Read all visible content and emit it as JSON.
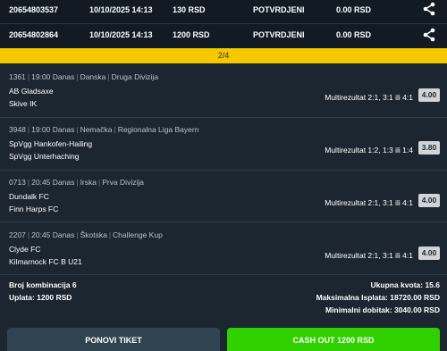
{
  "tickets": [
    {
      "id": "20654803537",
      "datetime": "10/10/2025 14:13",
      "amount": "130 RSD",
      "status": "POTVRDJENI",
      "win": "0.00 RSD",
      "share_icon": "share-icon"
    },
    {
      "id": "20654802864",
      "datetime": "10/10/2025 14:13",
      "amount": "1200 RSD",
      "status": "POTVRDJENI",
      "win": "0.00 RSD",
      "share_icon": "share-icon"
    }
  ],
  "pagination": {
    "label": "2/4"
  },
  "matches": [
    {
      "code": "1361",
      "time": "19:00 Danas",
      "country": "Danska",
      "league": "Druga Divizija",
      "home": "AB Gladsaxe",
      "away": "Skive IK",
      "tip": "Multirezultat 2:1, 3:1 ili 4:1",
      "odd": "4.00"
    },
    {
      "code": "3948",
      "time": "19:00 Danas",
      "country": "Nemačka",
      "league": "Regionalna Liga Bayern",
      "home": "SpVgg Hankofen-Hailing",
      "away": "SpVgg Unterhaching",
      "tip": "Multirezultat 1:2, 1:3 ili 1:4",
      "odd": "3.80"
    },
    {
      "code": "0713",
      "time": "20:45 Danas",
      "country": "Irska",
      "league": "Prva Divizija",
      "home": "Dundalk FC",
      "away": "Finn Harps FC",
      "tip": "Multirezultat 2:1, 3:1 ili 4:1",
      "odd": "4.00"
    },
    {
      "code": "2207",
      "time": "20:45 Danas",
      "country": "Škotska",
      "league": "Challenge Kup",
      "home": "Clyde FC",
      "away": "Kilmarnock FC B U21",
      "tip": "Multirezultat 2:1, 3:1 ili 4:1",
      "odd": "4.00"
    }
  ],
  "summary": {
    "combinations": "Broj kombinacija 6",
    "stake": "Uplata: 1200 RSD",
    "total_odds": "Ukupna kvota: 15.6",
    "max_payout": "Maksimalna Isplata: 18720.00 RSD",
    "min_win": "Minimalni dobitak: 3040.00 RSD"
  },
  "buttons": {
    "repeat": "PONOVI TIKET",
    "cashout": "CASH OUT 1200 RSD"
  },
  "colors": {
    "accent_yellow": "#f5c800",
    "cashout_green": "#31d100",
    "background": "#1c2630",
    "ticket_row_bg": "#121b24"
  }
}
